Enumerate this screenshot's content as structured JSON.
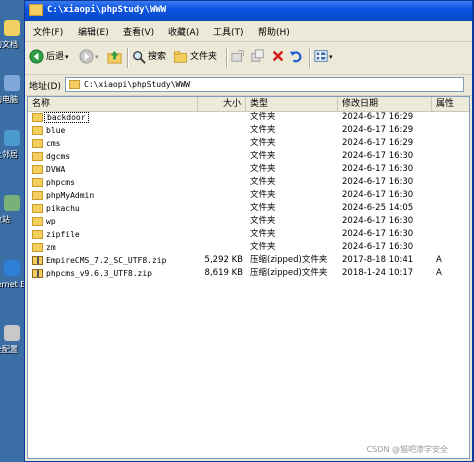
{
  "window": {
    "title": "C:\\xiaopi\\phpStudy\\WWW"
  },
  "desktop": {
    "icons": [
      {
        "label": "我的文档",
        "color": "#f3cf62"
      },
      {
        "label": "我的电脑",
        "color": "#7fa7d8"
      },
      {
        "label": "网上邻居",
        "color": "#4a9ad0"
      },
      {
        "label": "回收站",
        "color": "#7ab07a"
      },
      {
        "label": "Internet Explorer",
        "color": "#2f7fd6"
      },
      {
        "label": "安全配置",
        "color": "#c8c8c8"
      }
    ]
  },
  "menu": [
    "文件(F)",
    "编辑(E)",
    "查看(V)",
    "收藏(A)",
    "工具(T)",
    "帮助(H)"
  ],
  "toolbar": {
    "back": "后退",
    "search": "搜索",
    "folders": "文件夹"
  },
  "address": {
    "label": "地址(D)",
    "value": "C:\\xiaopi\\phpStudy\\WWW"
  },
  "columns": {
    "name": "名称",
    "size": "大小",
    "type": "类型",
    "modified": "修改日期",
    "attributes": "属性"
  },
  "files": [
    {
      "name": "backdoor",
      "size": "",
      "type": "文件夹",
      "modified": "2024-6-17 16:29",
      "attr": "",
      "kind": "folder"
    },
    {
      "name": "blue",
      "size": "",
      "type": "文件夹",
      "modified": "2024-6-17 16:29",
      "attr": "",
      "kind": "folder"
    },
    {
      "name": "cms",
      "size": "",
      "type": "文件夹",
      "modified": "2024-6-17 16:29",
      "attr": "",
      "kind": "folder"
    },
    {
      "name": "dgcms",
      "size": "",
      "type": "文件夹",
      "modified": "2024-6-17 16:30",
      "attr": "",
      "kind": "folder"
    },
    {
      "name": "DVWA",
      "size": "",
      "type": "文件夹",
      "modified": "2024-6-17 16:30",
      "attr": "",
      "kind": "folder"
    },
    {
      "name": "phpcms",
      "size": "",
      "type": "文件夹",
      "modified": "2024-6-17 16:30",
      "attr": "",
      "kind": "folder"
    },
    {
      "name": "phpMyAdmin",
      "size": "",
      "type": "文件夹",
      "modified": "2024-6-17 16:30",
      "attr": "",
      "kind": "folder"
    },
    {
      "name": "pikachu",
      "size": "",
      "type": "文件夹",
      "modified": "2024-6-25 14:05",
      "attr": "",
      "kind": "folder"
    },
    {
      "name": "wp",
      "size": "",
      "type": "文件夹",
      "modified": "2024-6-17 16:30",
      "attr": "",
      "kind": "folder"
    },
    {
      "name": "zipfile",
      "size": "",
      "type": "文件夹",
      "modified": "2024-6-17 16:30",
      "attr": "",
      "kind": "folder"
    },
    {
      "name": "zm",
      "size": "",
      "type": "文件夹",
      "modified": "2024-6-17 16:30",
      "attr": "",
      "kind": "folder"
    },
    {
      "name": "EmpireCMS_7.2_SC_UTF8.zip",
      "size": "5,292 KB",
      "type": "压缩(zipped)文件夹",
      "modified": "2017-8-18 10:41",
      "attr": "A",
      "kind": "zip"
    },
    {
      "name": "phpcms_v9.6.3_UTF8.zip",
      "size": "8,619 KB",
      "type": "压缩(zipped)文件夹",
      "modified": "2018-1-24 10:17",
      "attr": "A",
      "kind": "zip"
    }
  ],
  "watermark": "CSDN @猫吧渗学安全"
}
